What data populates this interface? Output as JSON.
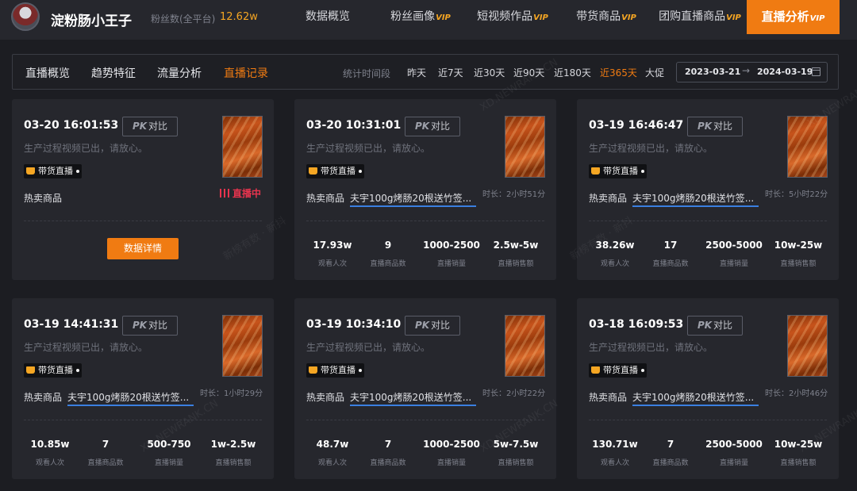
{
  "header": {
    "account_name": "淀粉肠小王子",
    "fans_label": "粉丝数(全平台)",
    "fans_value": "12.62w",
    "vip_badge": "VIP",
    "nav": [
      {
        "label": "数据概览",
        "vip": false
      },
      {
        "label": "粉丝画像",
        "vip": true
      },
      {
        "label": "短视频作品",
        "vip": true
      },
      {
        "label": "带货商品",
        "vip": true
      },
      {
        "label": "团购直播商品",
        "vip": true
      },
      {
        "label": "直播分析",
        "vip": true,
        "active": true
      }
    ]
  },
  "subnav": {
    "tabs": [
      "直播概览",
      "趋势特征",
      "流量分析",
      "直播记录"
    ],
    "active_tab": "直播记录",
    "period_label": "统计时间段",
    "period_options": [
      "昨天",
      "近7天",
      "近30天",
      "近90天",
      "近180天",
      "近365天",
      "大促"
    ],
    "active_period": "近365天",
    "date_start": "2023-03-21",
    "date_arrow": "→",
    "date_end": "2024-03-19"
  },
  "card_common": {
    "pk_prefix": "PK",
    "pk_label": "对比",
    "desc": "生产过程视频已出，请放心。",
    "tag_label": "带货直播",
    "hot_label": "热卖商品",
    "live_now_label": "直播中",
    "detail_button": "数据详情",
    "stat_labels": [
      "观看人次",
      "直播商品数",
      "直播销量",
      "直播销售额"
    ]
  },
  "cards": [
    {
      "time": "03-20 16:01:53",
      "live": true
    },
    {
      "time": "03-20 10:31:01",
      "product": "夫宇100g烤肠20根送竹签...",
      "duration": "时长：2小时51分",
      "stats": [
        "17.93w",
        "9",
        "1000-2500",
        "2.5w-5w"
      ]
    },
    {
      "time": "03-19 16:46:47",
      "product": "夫宇100g烤肠20根送竹签...",
      "duration": "时长：5小时22分",
      "stats": [
        "38.26w",
        "17",
        "2500-5000",
        "10w-25w"
      ]
    },
    {
      "time": "03-19 14:41:31",
      "product": "夫宇100g烤肠20根送竹签...",
      "duration": "时长：1小时29分",
      "stats": [
        "10.85w",
        "7",
        "500-750",
        "1w-2.5w"
      ]
    },
    {
      "time": "03-19 10:34:10",
      "product": "夫宇100g烤肠20根送竹签...",
      "duration": "时长：2小时22分",
      "stats": [
        "48.7w",
        "7",
        "1000-2500",
        "5w-7.5w"
      ]
    },
    {
      "time": "03-18 16:09:53",
      "product": "夫宇100g烤肠20根送竹签...",
      "duration": "时长：2小时46分",
      "stats": [
        "130.71w",
        "7",
        "2500-5000",
        "10w-25w"
      ]
    }
  ],
  "watermarks": [
    "XD.NEWRANK.CN",
    "新榜有数 · 新抖"
  ]
}
